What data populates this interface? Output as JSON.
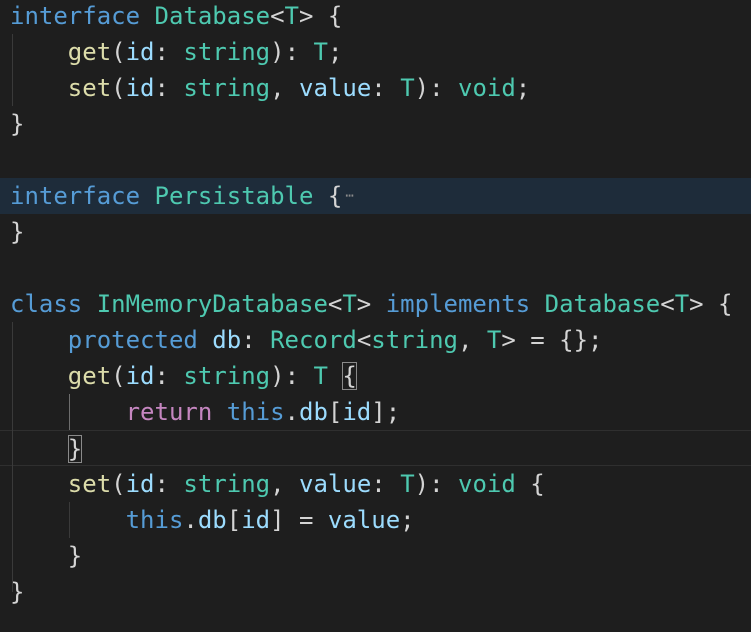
{
  "colors": {
    "background": "#1e1e1e",
    "keyword": "#569cd6",
    "type": "#4ec9b0",
    "function": "#dcdcaa",
    "variable": "#9cdcfe",
    "control": "#c586c0",
    "punctuation": "#d4d4d4"
  },
  "lines": [
    {
      "name": "line-interface-database",
      "tokens": [
        {
          "text": "interface",
          "color": "#569cd6"
        },
        {
          "text": " ",
          "color": "#d4d4d4"
        },
        {
          "text": "Database",
          "color": "#4ec9b0"
        },
        {
          "text": "<",
          "color": "#d4d4d4"
        },
        {
          "text": "T",
          "color": "#4ec9b0"
        },
        {
          "text": "> {",
          "color": "#d4d4d4"
        }
      ]
    },
    {
      "name": "line-get-signature",
      "tokens": [
        {
          "text": "    ",
          "color": "#d4d4d4"
        },
        {
          "text": "get",
          "color": "#dcdcaa"
        },
        {
          "text": "(",
          "color": "#d4d4d4"
        },
        {
          "text": "id",
          "color": "#9cdcfe"
        },
        {
          "text": ": ",
          "color": "#d4d4d4"
        },
        {
          "text": "string",
          "color": "#4ec9b0"
        },
        {
          "text": "): ",
          "color": "#d4d4d4"
        },
        {
          "text": "T",
          "color": "#4ec9b0"
        },
        {
          "text": ";",
          "color": "#d4d4d4"
        }
      ]
    },
    {
      "name": "line-set-signature",
      "tokens": [
        {
          "text": "    ",
          "color": "#d4d4d4"
        },
        {
          "text": "set",
          "color": "#dcdcaa"
        },
        {
          "text": "(",
          "color": "#d4d4d4"
        },
        {
          "text": "id",
          "color": "#9cdcfe"
        },
        {
          "text": ": ",
          "color": "#d4d4d4"
        },
        {
          "text": "string",
          "color": "#4ec9b0"
        },
        {
          "text": ", ",
          "color": "#d4d4d4"
        },
        {
          "text": "value",
          "color": "#9cdcfe"
        },
        {
          "text": ": ",
          "color": "#d4d4d4"
        },
        {
          "text": "T",
          "color": "#4ec9b0"
        },
        {
          "text": "): ",
          "color": "#d4d4d4"
        },
        {
          "text": "void",
          "color": "#4ec9b0"
        },
        {
          "text": ";",
          "color": "#d4d4d4"
        }
      ]
    },
    {
      "name": "line-close-database",
      "tokens": [
        {
          "text": "}",
          "color": "#d4d4d4"
        }
      ]
    },
    {
      "name": "line-blank-1",
      "tokens": []
    },
    {
      "name": "line-interface-persistable",
      "highlight": true,
      "folded": true,
      "tokens": [
        {
          "text": "interface",
          "color": "#569cd6"
        },
        {
          "text": " ",
          "color": "#d4d4d4"
        },
        {
          "text": "Persistable",
          "color": "#4ec9b0"
        },
        {
          "text": " {",
          "color": "#d4d4d4"
        }
      ]
    },
    {
      "name": "line-close-persistable",
      "tokens": [
        {
          "text": "}",
          "color": "#d4d4d4"
        }
      ]
    },
    {
      "name": "line-blank-2",
      "tokens": []
    },
    {
      "name": "line-class-declaration",
      "tokens": [
        {
          "text": "class",
          "color": "#569cd6"
        },
        {
          "text": " ",
          "color": "#d4d4d4"
        },
        {
          "text": "InMemoryDatabase",
          "color": "#4ec9b0"
        },
        {
          "text": "<",
          "color": "#d4d4d4"
        },
        {
          "text": "T",
          "color": "#4ec9b0"
        },
        {
          "text": "> ",
          "color": "#d4d4d4"
        },
        {
          "text": "implements",
          "color": "#569cd6"
        },
        {
          "text": " ",
          "color": "#d4d4d4"
        },
        {
          "text": "Database",
          "color": "#4ec9b0"
        },
        {
          "text": "<",
          "color": "#d4d4d4"
        },
        {
          "text": "T",
          "color": "#4ec9b0"
        },
        {
          "text": "> {",
          "color": "#d4d4d4"
        }
      ]
    },
    {
      "name": "line-protected-db",
      "tokens": [
        {
          "text": "    ",
          "color": "#d4d4d4"
        },
        {
          "text": "protected",
          "color": "#569cd6"
        },
        {
          "text": " ",
          "color": "#d4d4d4"
        },
        {
          "text": "db",
          "color": "#9cdcfe"
        },
        {
          "text": ": ",
          "color": "#d4d4d4"
        },
        {
          "text": "Record",
          "color": "#4ec9b0"
        },
        {
          "text": "<",
          "color": "#d4d4d4"
        },
        {
          "text": "string",
          "color": "#4ec9b0"
        },
        {
          "text": ", ",
          "color": "#d4d4d4"
        },
        {
          "text": "T",
          "color": "#4ec9b0"
        },
        {
          "text": "> = {};",
          "color": "#d4d4d4"
        }
      ]
    },
    {
      "name": "line-get-method",
      "tokens": [
        {
          "text": "    ",
          "color": "#d4d4d4"
        },
        {
          "text": "get",
          "color": "#dcdcaa"
        },
        {
          "text": "(",
          "color": "#d4d4d4"
        },
        {
          "text": "id",
          "color": "#9cdcfe"
        },
        {
          "text": ": ",
          "color": "#d4d4d4"
        },
        {
          "text": "string",
          "color": "#4ec9b0"
        },
        {
          "text": "): ",
          "color": "#d4d4d4"
        },
        {
          "text": "T",
          "color": "#4ec9b0"
        },
        {
          "text": " ",
          "color": "#d4d4d4"
        },
        {
          "text": "{",
          "color": "#d4d4d4",
          "match": true
        }
      ]
    },
    {
      "name": "line-return",
      "tokens": [
        {
          "text": "        ",
          "color": "#d4d4d4"
        },
        {
          "text": "return",
          "color": "#c586c0"
        },
        {
          "text": " ",
          "color": "#d4d4d4"
        },
        {
          "text": "this",
          "color": "#569cd6"
        },
        {
          "text": ".",
          "color": "#d4d4d4"
        },
        {
          "text": "db",
          "color": "#9cdcfe"
        },
        {
          "text": "[",
          "color": "#d4d4d4"
        },
        {
          "text": "id",
          "color": "#9cdcfe"
        },
        {
          "text": "];",
          "color": "#d4d4d4"
        }
      ]
    },
    {
      "name": "line-close-get",
      "cursor": true,
      "tokens": [
        {
          "text": "    ",
          "color": "#d4d4d4"
        },
        {
          "text": "}",
          "color": "#d4d4d4",
          "match": true
        }
      ]
    },
    {
      "name": "line-set-method",
      "tokens": [
        {
          "text": "    ",
          "color": "#d4d4d4"
        },
        {
          "text": "set",
          "color": "#dcdcaa"
        },
        {
          "text": "(",
          "color": "#d4d4d4"
        },
        {
          "text": "id",
          "color": "#9cdcfe"
        },
        {
          "text": ": ",
          "color": "#d4d4d4"
        },
        {
          "text": "string",
          "color": "#4ec9b0"
        },
        {
          "text": ", ",
          "color": "#d4d4d4"
        },
        {
          "text": "value",
          "color": "#9cdcfe"
        },
        {
          "text": ": ",
          "color": "#d4d4d4"
        },
        {
          "text": "T",
          "color": "#4ec9b0"
        },
        {
          "text": "): ",
          "color": "#d4d4d4"
        },
        {
          "text": "void",
          "color": "#4ec9b0"
        },
        {
          "text": " {",
          "color": "#d4d4d4"
        }
      ]
    },
    {
      "name": "line-assign",
      "tokens": [
        {
          "text": "        ",
          "color": "#d4d4d4"
        },
        {
          "text": "this",
          "color": "#569cd6"
        },
        {
          "text": ".",
          "color": "#d4d4d4"
        },
        {
          "text": "db",
          "color": "#9cdcfe"
        },
        {
          "text": "[",
          "color": "#d4d4d4"
        },
        {
          "text": "id",
          "color": "#9cdcfe"
        },
        {
          "text": "] = ",
          "color": "#d4d4d4"
        },
        {
          "text": "value",
          "color": "#9cdcfe"
        },
        {
          "text": ";",
          "color": "#d4d4d4"
        }
      ]
    },
    {
      "name": "line-close-set",
      "tokens": [
        {
          "text": "    ",
          "color": "#d4d4d4"
        },
        {
          "text": "}",
          "color": "#d4d4d4"
        }
      ]
    },
    {
      "name": "line-close-class",
      "tokens": [
        {
          "text": "}",
          "color": "#d4d4d4"
        }
      ]
    }
  ]
}
